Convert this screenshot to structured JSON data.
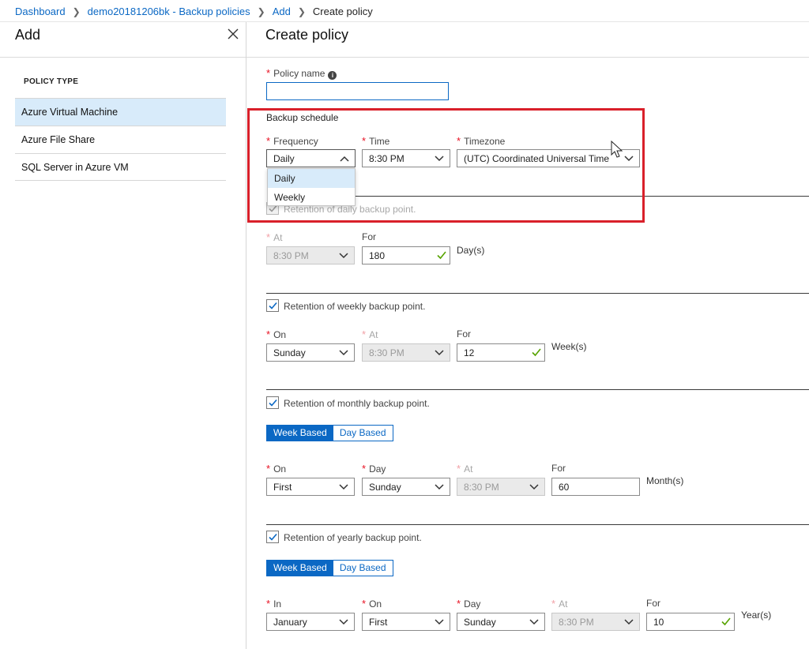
{
  "breadcrumb": {
    "items": [
      "Dashboard",
      "demo20181206bk - Backup policies",
      "Add"
    ],
    "current": "Create policy"
  },
  "left_blade": {
    "title": "Add",
    "section_label": "POLICY TYPE",
    "policy_types": [
      "Azure Virtual Machine",
      "Azure File Share",
      "SQL Server in Azure VM"
    ],
    "selected_index": 0
  },
  "right_blade": {
    "title": "Create policy",
    "policy_name": {
      "label": "Policy name",
      "value": ""
    },
    "backup_schedule": {
      "heading": "Backup schedule",
      "frequency": {
        "label": "Frequency",
        "value": "Daily",
        "options": [
          "Daily",
          "Weekly"
        ],
        "highlighted": "Daily"
      },
      "time": {
        "label": "Time",
        "value": "8:30 PM"
      },
      "timezone": {
        "label": "Timezone",
        "value": "(UTC) Coordinated Universal Time"
      }
    },
    "daily_retention": {
      "label": "Retention of daily backup point.",
      "checked": true,
      "at": {
        "label": "At",
        "value": "8:30 PM"
      },
      "for": {
        "label": "For",
        "value": "180"
      },
      "unit": "Day(s)"
    },
    "weekly_retention": {
      "label": "Retention of weekly backup point.",
      "checked": true,
      "on": {
        "label": "On",
        "value": "Sunday"
      },
      "at": {
        "label": "At",
        "value": "8:30 PM"
      },
      "for": {
        "label": "For",
        "value": "12"
      },
      "unit": "Week(s)"
    },
    "monthly_retention": {
      "label": "Retention of monthly backup point.",
      "checked": true,
      "toggle": {
        "week_based": "Week Based",
        "day_based": "Day Based",
        "active": "week_based"
      },
      "on": {
        "label": "On",
        "value": "First"
      },
      "day": {
        "label": "Day",
        "value": "Sunday"
      },
      "at": {
        "label": "At",
        "value": "8:30 PM"
      },
      "for": {
        "label": "For",
        "value": "60"
      },
      "unit": "Month(s)"
    },
    "yearly_retention": {
      "label": "Retention of yearly backup point.",
      "checked": true,
      "toggle": {
        "week_based": "Week Based",
        "day_based": "Day Based",
        "active": "week_based"
      },
      "in": {
        "label": "In",
        "value": "January"
      },
      "on": {
        "label": "On",
        "value": "First"
      },
      "day": {
        "label": "Day",
        "value": "Sunday"
      },
      "at": {
        "label": "At",
        "value": "8:30 PM"
      },
      "for": {
        "label": "For",
        "value": "10"
      },
      "unit": "Year(s)"
    }
  },
  "colors": {
    "accent": "#0b68c4",
    "required": "#e81123",
    "highlight": "#d9202a",
    "valid": "#57a300",
    "selected_bg": "#d8ebfa"
  },
  "icons": {
    "close": "close-icon",
    "chevron": "chevron-down-icon",
    "info": "info-icon",
    "valid": "checkmark-icon",
    "checkbox": "checkbox-checked-icon"
  }
}
